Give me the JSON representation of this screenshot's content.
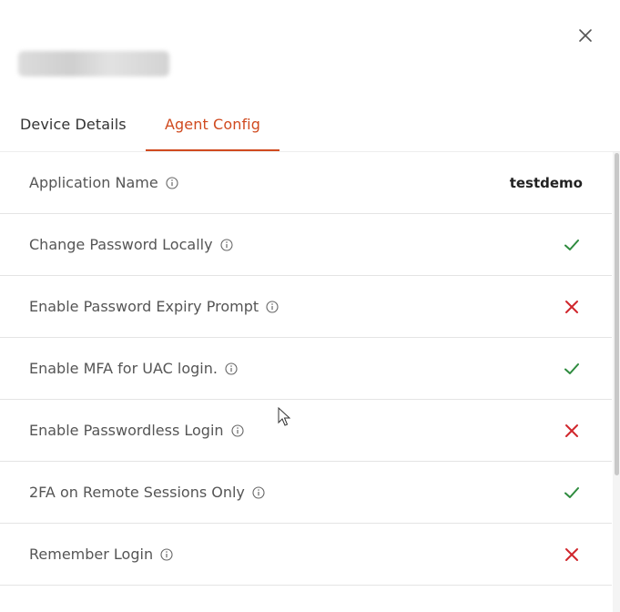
{
  "header": {
    "close_icon": "close-icon"
  },
  "tabs": [
    {
      "label": "Device Details",
      "active": false
    },
    {
      "label": "Agent Config",
      "active": true
    }
  ],
  "colors": {
    "accent": "#d04a1f",
    "check": "#2e8b3e",
    "cross": "#d0262c"
  },
  "config": {
    "rows": [
      {
        "label": "Application Name",
        "value": "testdemo"
      },
      {
        "label": "Change Password Locally",
        "status": "check-icon"
      },
      {
        "label": "Enable Password Expiry Prompt",
        "status": "cross-icon"
      },
      {
        "label": "Enable MFA for UAC login.",
        "status": "check-icon"
      },
      {
        "label": "Enable Passwordless Login",
        "status": "cross-icon"
      },
      {
        "label": "2FA on Remote Sessions Only",
        "status": "check-icon"
      },
      {
        "label": "Remember Login",
        "status": "cross-icon"
      }
    ]
  }
}
